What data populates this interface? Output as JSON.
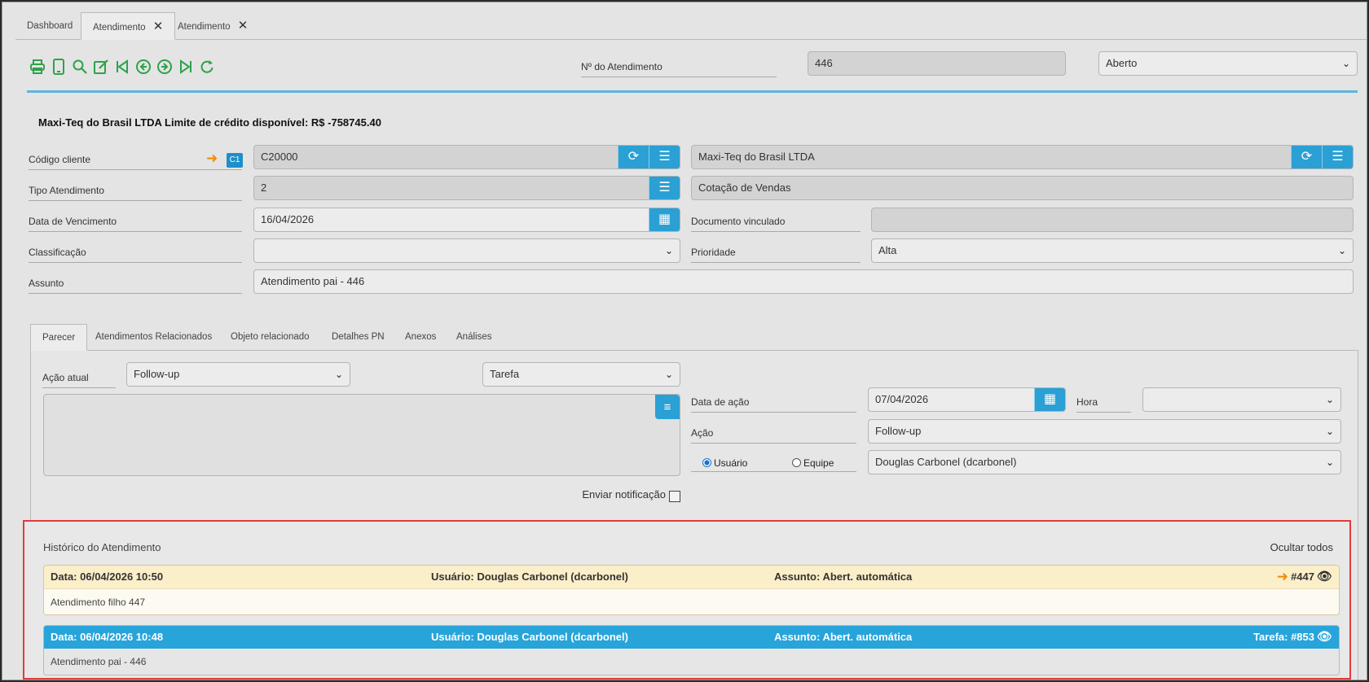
{
  "tabs": [
    {
      "label": "Dashboard",
      "closable": false
    },
    {
      "label": "Atendimento",
      "closable": true,
      "active": true
    },
    {
      "label": "Atendimento",
      "closable": true
    }
  ],
  "toolbar_icons": [
    "print-icon",
    "mobile-icon",
    "search-icon",
    "edit-icon",
    "first-icon",
    "prev-icon",
    "next-icon",
    "last-icon",
    "refresh-icon"
  ],
  "header": {
    "number_label": "Nº do Atendimento",
    "number_value": "446",
    "status_value": "Aberto"
  },
  "credit_text": "Maxi-Teq do Brasil LTDA Limite de crédito disponível: R$ -758745.40",
  "form": {
    "codigo_cliente_label": "Código cliente",
    "codigo_cliente_badge": "C1",
    "codigo_cliente_value": "C20000",
    "cliente_nome_value": "Maxi-Teq do Brasil LTDA",
    "tipo_label": "Tipo Atendimento",
    "tipo_value": "2",
    "tipo_desc_value": "Cotação de Vendas",
    "vencimento_label": "Data de Vencimento",
    "vencimento_value": "16/04/2026",
    "documento_label": "Documento vinculado",
    "documento_value": "",
    "classificacao_label": "Classificação",
    "classificacao_value": "",
    "prioridade_label": "Prioridade",
    "prioridade_value": "Alta",
    "assunto_label": "Assunto",
    "assunto_value": "Atendimento pai - 446"
  },
  "subtabs": [
    "Parecer",
    "Atendimentos Relacionados",
    "Objeto relacionado",
    "Detalhes PN",
    "Anexos",
    "Análises"
  ],
  "parecer": {
    "acao_atual_label": "Ação atual",
    "acao_atual_value": "Follow-up",
    "tipo_value": "Tarefa",
    "data_acao_label": "Data de ação",
    "data_acao_value": "07/04/2026",
    "hora_label": "Hora",
    "hora_value": "",
    "acao_label": "Ação",
    "acao_value": "Follow-up",
    "usuario_radio": "Usuário",
    "equipe_radio": "Equipe",
    "responsavel_value": "Douglas Carbonel (dcarbonel)",
    "notificacao_label": "Enviar notificação"
  },
  "history": {
    "title": "Histórico do Atendimento",
    "hide_all": "Ocultar todos",
    "entries": [
      {
        "date": "Data: 06/04/2026 10:50",
        "user": "Usuário: Douglas Carbonel (dcarbonel)",
        "subject": "Assunto: Abert. automática",
        "ref": "#447",
        "body": "Atendimento filho 447"
      },
      {
        "date": "Data: 06/04/2026 10:48",
        "user": "Usuário: Douglas Carbonel (dcarbonel)",
        "subject": "Assunto: Abert. automática",
        "ref": "Tarefa: #853",
        "body": "Atendimento pai - 446"
      }
    ]
  },
  "colors": {
    "accent_blue": "#2aa0d4",
    "toolbar_green": "#2ea24a",
    "highlight_red": "#e23b3b",
    "history_yellow": "#fbefc9"
  }
}
